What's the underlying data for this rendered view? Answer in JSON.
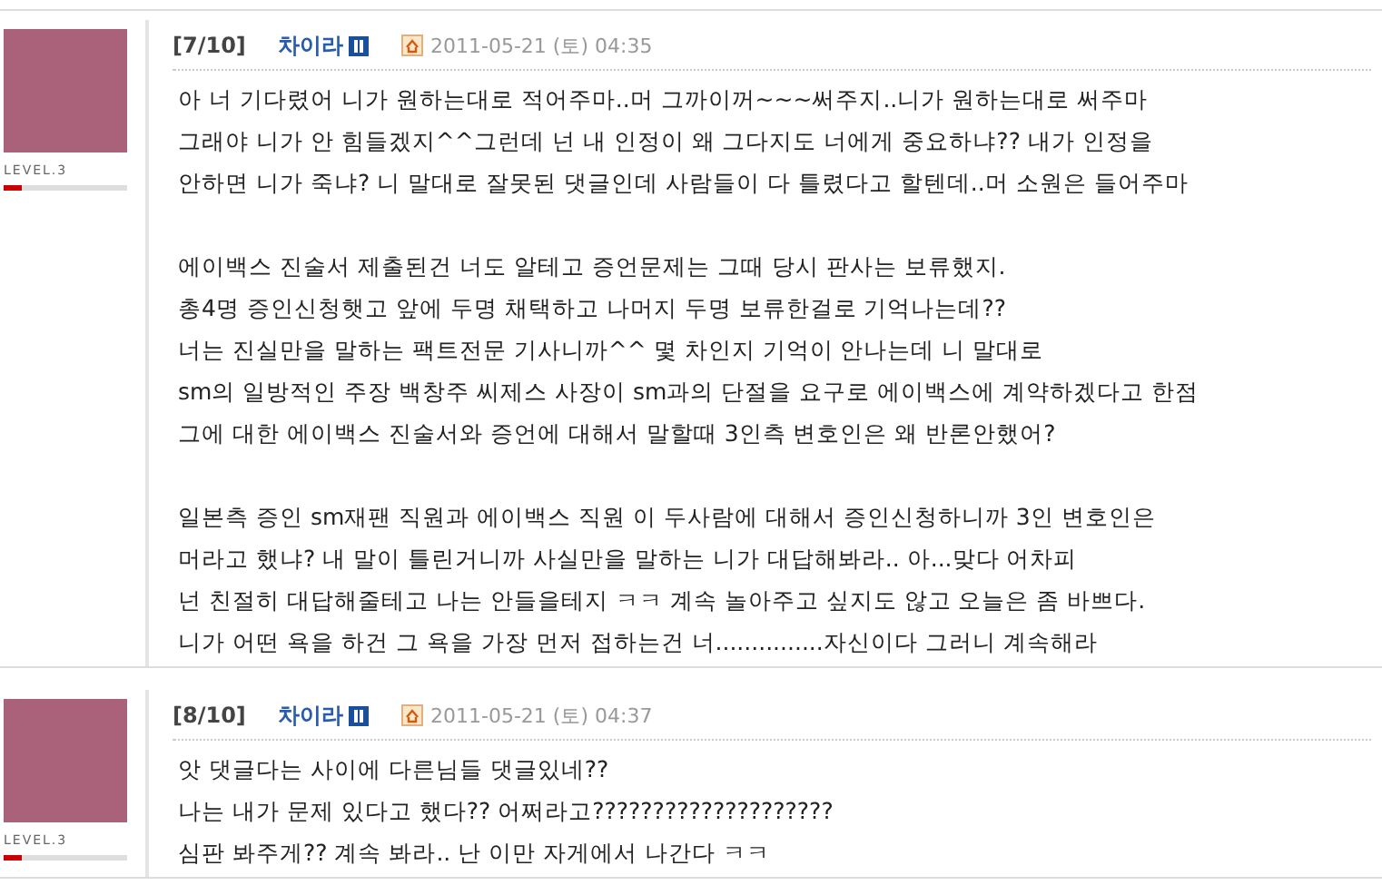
{
  "posts": [
    {
      "index": "[7/10]",
      "author": "차이라",
      "level_label": "LEVEL.3",
      "level": 0.15,
      "date": "2011-05-21 (토) 04:35",
      "paragraphs": [
        [
          "아 너 기다렸어 니가 원하는대로 적어주마..머 그까이꺼~~~써주지..니가 원하는대로 써주마",
          "그래야 니가 안 힘들겠지^^그런데 넌 내 인정이 왜 그다지도 너에게 중요하냐?? 내가 인정을",
          "안하면 니가 죽냐? 니 말대로 잘못된 댓글인데 사람들이 다 틀렸다고 할텐데..머 소원은 들어주마"
        ],
        [
          "에이백스 진술서 제출된건 너도 알테고 증언문제는 그때 당시 판사는 보류했지.",
          "총4명 증인신청햇고 앞에 두명 채택하고 나머지 두명 보류한걸로 기억나는데??",
          "너는 진실만을 말하는 팩트전문 기사니까^^ 몇 차인지 기억이 안나는데 니 말대로",
          "sm의 일방적인 주장 백창주 씨제스 사장이 sm과의 단절을 요구로 에이백스에 계약하겠다고 한점",
          "그에 대한 에이백스 진술서와 증언에 대해서 말할때 3인측 변호인은 왜 반론안했어?"
        ],
        [
          "일본측 증인 sm재팬 직원과 에이백스 직원 이 두사람에 대해서 증인신청하니까 3인 변호인은",
          "머라고 했냐? 내 말이 틀린거니까 사실만을 말하는 니가 대답해봐라.. 아...맞다 어차피",
          "넌 친절히 대답해줄테고 나는 안들을테지 ㅋㅋ 계속 놀아주고 싶지도 않고 오늘은 좀 바쁘다.",
          "니가 어떤 욕을 하건 그 욕을 가장 먼저 접하는건 너...............자신이다 그러니 계속해라"
        ]
      ]
    },
    {
      "index": "[8/10]",
      "author": "차이라",
      "level_label": "LEVEL.3",
      "level": 0.15,
      "date": "2011-05-21 (토) 04:37",
      "paragraphs": [
        [
          "앗 댓글다는 사이에 다른님들 댓글있네??",
          "나는 내가 문제 있다고 했다?? 어쩌라고????????????????????",
          "심판 봐주게?? 계속 봐라.. 난 이만 자게에서 나간다 ㅋㅋ"
        ]
      ]
    }
  ]
}
